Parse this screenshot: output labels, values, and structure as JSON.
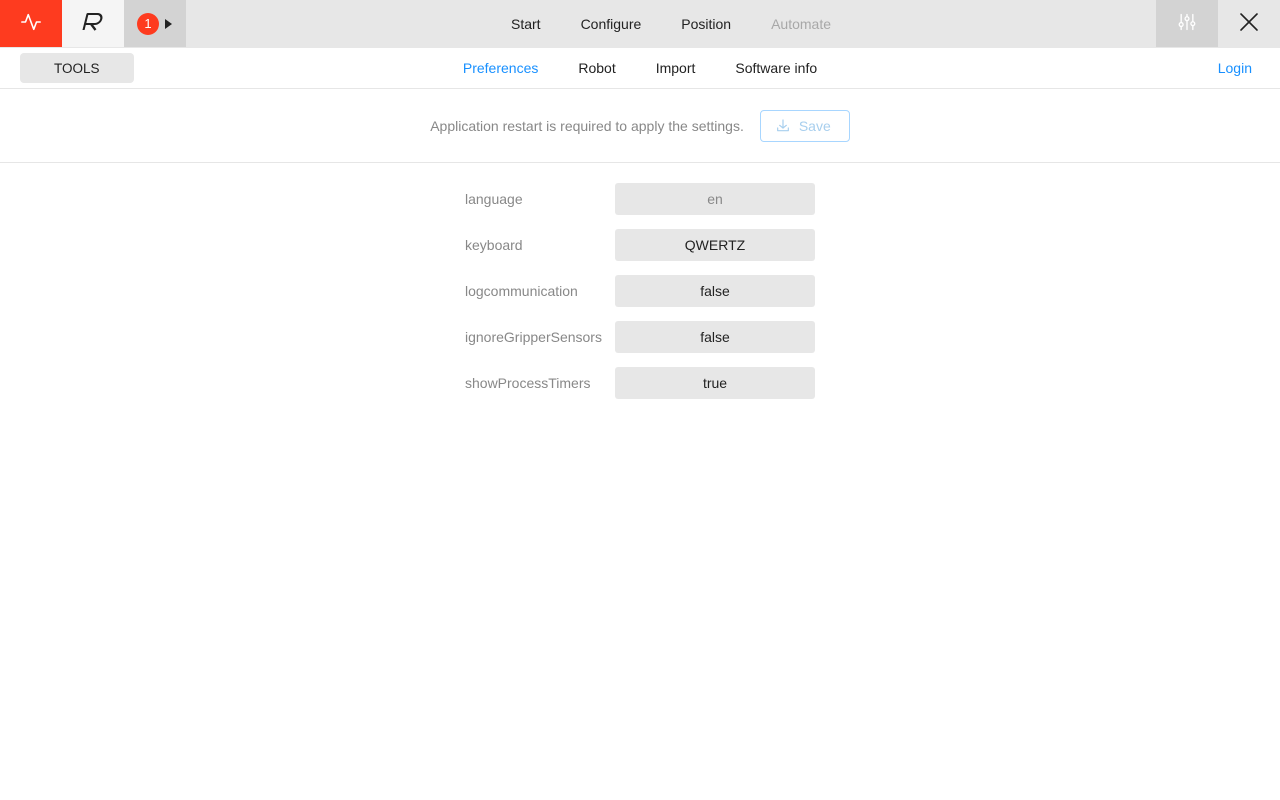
{
  "topbar": {
    "step_badge": "1",
    "nav": [
      {
        "label": "Start",
        "disabled": false
      },
      {
        "label": "Configure",
        "disabled": false
      },
      {
        "label": "Position",
        "disabled": false
      },
      {
        "label": "Automate",
        "disabled": true
      }
    ]
  },
  "subbar": {
    "tools_label": "TOOLS",
    "tabs": [
      {
        "label": "Preferences",
        "active": true
      },
      {
        "label": "Robot",
        "active": false
      },
      {
        "label": "Import",
        "active": false
      },
      {
        "label": "Software info",
        "active": false
      }
    ],
    "login_label": "Login"
  },
  "save_row": {
    "hint": "Application restart is required to apply the settings.",
    "save_label": "Save"
  },
  "settings": [
    {
      "label": "language",
      "value": "en",
      "muted": true
    },
    {
      "label": "keyboard",
      "value": "QWERTZ",
      "muted": false
    },
    {
      "label": "logcommunication",
      "value": "false",
      "muted": false
    },
    {
      "label": "ignoreGripperSensors",
      "value": "false",
      "muted": false
    },
    {
      "label": "showProcessTimers",
      "value": "true",
      "muted": false
    }
  ],
  "colors": {
    "accent_red": "#fe3b1f",
    "accent_blue": "#1890ff"
  }
}
